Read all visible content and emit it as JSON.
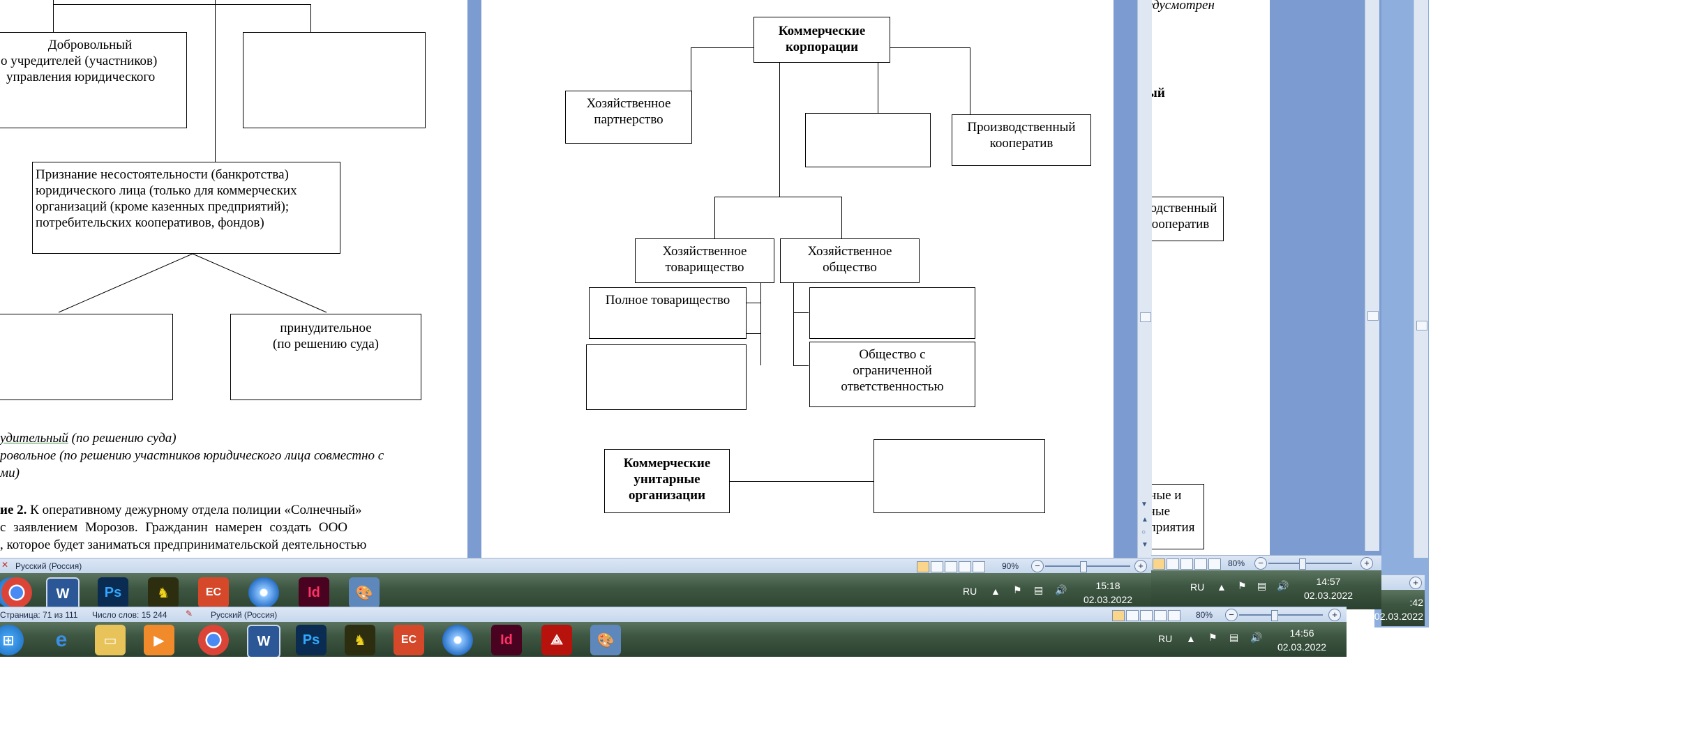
{
  "left_doc": {
    "box_voluntary_title": "Добровольный",
    "box_voluntary_line1": "о учредителей (участников)",
    "box_voluntary_line2": "управления юридического",
    "box_bankruptcy_l1": "Признание несостоятельности (банкротства)",
    "box_bankruptcy_l2": "юридического лица (только для коммерческих",
    "box_bankruptcy_l3": "организаций (кроме казенных предприятий);",
    "box_bankruptcy_l4": "потребительских кооперативов, фондов)",
    "box_forced_l1": "принудительное",
    "box_forced_l2": "(по решению суда)",
    "text_forced": "удительный",
    "text_forced_rest": " (по решению суда)",
    "text_vol": "ровольное (по решению участников юридического лица совместно с",
    "text_vol2": "ми)",
    "task_bold": "ие 2.",
    "task_l1": " К оперативному дежурному отдела полиции «Солнечный»",
    "task_l2": "с заявлением Морозов. Гражданин намерен создать ООО",
    "task_l3": ", которое будет заниматься предпринимательской деятельностью"
  },
  "center_doc": {
    "commercial_corps_l1": "Коммерческие",
    "commercial_corps_l2": "корпорации",
    "econ_partnership_l1": "Хозяйственное",
    "econ_partnership_l2": "партнерство",
    "prod_coop_l1": "Производственный",
    "prod_coop_l2": "кооператив",
    "econ_company_l1": "Хозяйственное",
    "econ_company_l2": "товарищество",
    "econ_society_l1": "Хозяйственное",
    "econ_society_l2": "общество",
    "full_partnership": "Полное товарищество",
    "llc_l1": "Общество с",
    "llc_l2": "ограниченной",
    "llc_l3": "ответственностью",
    "unitary_l1": "Коммерческие",
    "unitary_l2": "унитарные",
    "unitary_l3": "организации"
  },
  "right_doc": {
    "top_italic": "едусмотрен",
    "bold_frag": "ый",
    "coop_l1": "водственный",
    "coop_l2": "ооператив",
    "frag_l1": "нные и",
    "frag_l2": "ьные",
    "frag_l3": "дприятия"
  },
  "statusbar_main": {
    "language": "Русский (Россия)",
    "zoom": "90%"
  },
  "statusbar_bottom": {
    "page": "Страница: 71 из 111",
    "words": "Число слов: 15 244",
    "language": "Русский (Россия)",
    "zoom": "80%"
  },
  "statusbar_right": {
    "zoom": "80%"
  },
  "taskbar_main": {
    "lang": "RU",
    "time": "15:18",
    "date": "02.03.2022"
  },
  "taskbar_right": {
    "lang": "RU",
    "time": "14:57",
    "date": "02.03.2022"
  },
  "taskbar_far": {
    "time": ":42",
    "date": "02.03.2022"
  },
  "taskbar_bottom": {
    "lang": "RU",
    "time": "14:56",
    "date": "02.03.2022"
  },
  "colors": {
    "word_blue": "#2b5797",
    "taskbar_green": "#3d5641",
    "doc_frame_blue": "#7b9bd1"
  }
}
